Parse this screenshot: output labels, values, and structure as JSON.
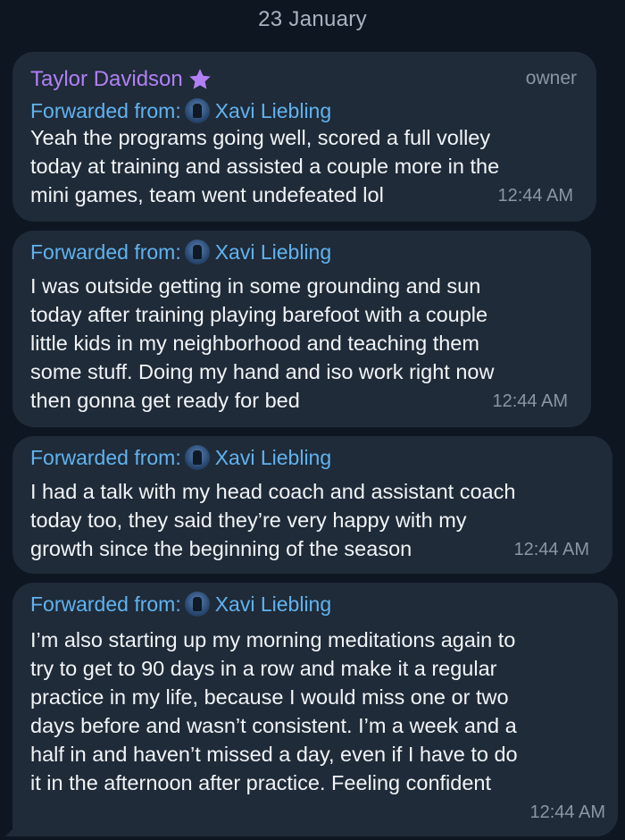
{
  "date_header": "23 January",
  "sender": {
    "name": "Taylor Davidson",
    "role": "owner",
    "name_color": "#b180f5",
    "badge_icon": "star-icon"
  },
  "forward": {
    "label": "Forwarded from:",
    "name": "Xavi Liebling"
  },
  "messages": [
    {
      "lines": [
        "Yeah the programs going well, scored a full volley",
        "today at training and assisted a couple more in the",
        "mini games, team went undefeated lol"
      ],
      "time": "12:44 AM"
    },
    {
      "lines": [
        "I was outside getting in some grounding and sun",
        "today after training playing barefoot with a couple",
        "little kids in my neighborhood and teaching them",
        "some stuff. Doing my hand and iso work right now",
        "then gonna get ready for bed"
      ],
      "time": "12:44 AM"
    },
    {
      "lines": [
        "I had a talk with my head coach and assistant coach",
        "today too, they said they’re very happy with my",
        "growth since the beginning of the season"
      ],
      "time": "12:44 AM"
    },
    {
      "lines": [
        "I’m also starting up my morning meditations again to",
        "try to get to 90 days in a row and make it a regular",
        "practice in my life, because I would miss one or two",
        "days before and wasn’t consistent. I’m a week and a",
        "half in and haven’t missed a day, even if I have to do",
        "it in the afternoon after practice. Feeling confident"
      ],
      "time": "12:44 AM"
    }
  ]
}
